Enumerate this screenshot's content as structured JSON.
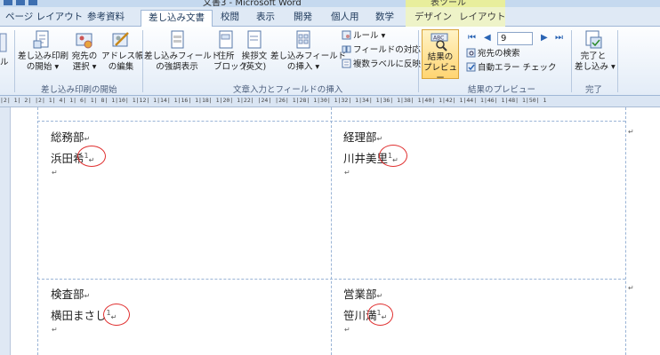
{
  "window": {
    "title": "文書3 - Microsoft Word",
    "context_group": "表ツール"
  },
  "tabs": [
    {
      "label": "ページ レイアウト"
    },
    {
      "label": "参考資料"
    },
    {
      "label": "差し込み文書"
    },
    {
      "label": "校閲"
    },
    {
      "label": "表示"
    },
    {
      "label": "開発"
    },
    {
      "label": "個人用"
    },
    {
      "label": "数学"
    },
    {
      "label": "デザイン"
    },
    {
      "label": "レイアウト"
    }
  ],
  "ribbon": {
    "group1": {
      "label": "差し込み印刷の開始",
      "start": {
        "line1": "差し込み印刷",
        "line2": "の開始 ▾"
      },
      "recipients": {
        "line1": "宛先の",
        "line2": "選択 ▾"
      },
      "edit_list": {
        "line1": "アドレス帳",
        "line2": "の編集"
      }
    },
    "group2": {
      "label": "文章入力とフィールドの挿入",
      "highlight": {
        "line1": "差し込みフィールド",
        "line2": "の強調表示"
      },
      "address": {
        "line1": "住所",
        "line2": "ブロック"
      },
      "greeting": {
        "line1": "挨拶文",
        "line2": "(英文)"
      },
      "insert_field": {
        "line1": "差し込みフィールド",
        "line2": "の挿入 ▾"
      },
      "rules": "ルール ▾",
      "match_fields": "フィールドの対応",
      "update_labels": "複数ラベルに反映"
    },
    "group3": {
      "label": "結果のプレビュー",
      "preview": {
        "line1": "結果の",
        "line2": "プレビュー"
      },
      "record": "9",
      "find": "宛先の検索",
      "auto_check": "自動エラー チェック"
    },
    "group4": {
      "label": "完了",
      "finish": {
        "line1": "完了と",
        "line2": "差し込み ▾"
      }
    },
    "left_cut": "ル"
  },
  "ruler": "|2| 1| 2| |2| 1| 4| 1| 6| 1| 8| 1|10| 1|12| 1|14| 1|16| 1|18| 1|20| 1|22| |24| |26| 1|28| 1|30| 1|32| 1|34| 1|36| 1|38| 1|40| 1|42| 1|44| 1|46| 1|48| 1|50| 1",
  "labels": [
    {
      "dept": "総務部",
      "name": "浜田希",
      "mark": "1"
    },
    {
      "dept": "経理部",
      "name": "川井美里",
      "mark": "1"
    },
    {
      "dept": "検査部",
      "name": "横田まさし",
      "mark": "1"
    },
    {
      "dept": "営業部",
      "name": "笹川満",
      "mark": "1"
    }
  ],
  "para_mark": "↵"
}
